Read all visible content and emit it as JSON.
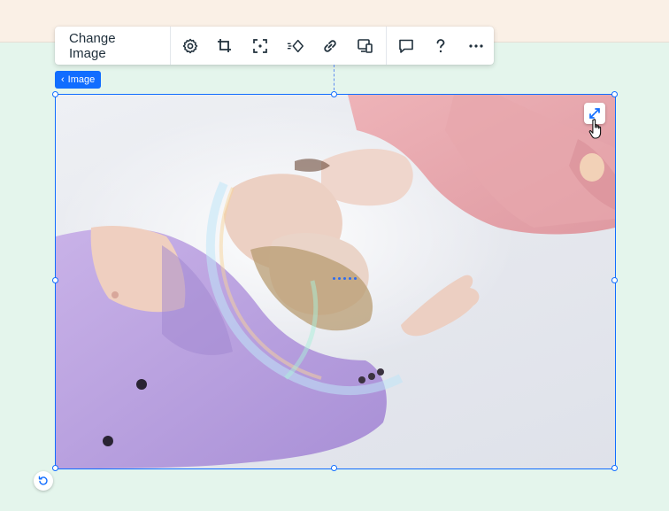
{
  "toolbar": {
    "change_image_label": "Change Image",
    "icons": [
      "settings-icon",
      "crop-icon",
      "focal-point-icon",
      "animation-icon",
      "link-icon",
      "responsive-icon",
      "comment-icon",
      "help-icon",
      "more-icon"
    ]
  },
  "element_chip": {
    "label": "Image"
  },
  "colors": {
    "accent": "#116dff",
    "canvas_bg": "#e4f5ec",
    "header_bg": "#faf0e6"
  }
}
